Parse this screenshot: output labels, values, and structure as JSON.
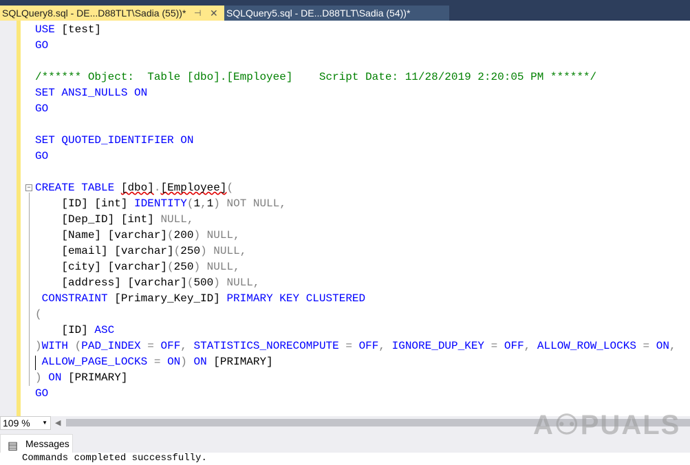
{
  "tabs": [
    {
      "label": "SQLQuery8.sql - DE...D88TLT\\Sadia (55))*",
      "active": true
    },
    {
      "label": "SQLQuery5.sql - DE...D88TLT\\Sadia (54))*",
      "active": false
    }
  ],
  "icons": {
    "pin": "⊣",
    "close": "✕",
    "collapse": "−",
    "zoom_dropdown": "▼",
    "scroll_left": "◀",
    "messages": "▤"
  },
  "colors": {
    "keyword": "#0000ff",
    "operator": "#808080",
    "comment": "#008000",
    "tab_active": "#ffe88a"
  },
  "code_lines": [
    [
      [
        "USE",
        "k"
      ],
      [
        " [test]",
        "n"
      ]
    ],
    [
      [
        "GO",
        "k"
      ]
    ],
    [],
    [
      [
        "/****** Object:  Table [dbo].[Employee]    Script Date: 11/28/2019 2:20:05 PM ******/",
        "c"
      ]
    ],
    [
      [
        "SET",
        "k"
      ],
      [
        " ",
        "n"
      ],
      [
        "ANSI_NULLS",
        "k"
      ],
      [
        " ",
        "n"
      ],
      [
        "ON",
        "k"
      ]
    ],
    [
      [
        "GO",
        "k"
      ]
    ],
    [],
    [
      [
        "SET",
        "k"
      ],
      [
        " ",
        "n"
      ],
      [
        "QUOTED_IDENTIFIER",
        "k"
      ],
      [
        " ",
        "n"
      ],
      [
        "ON",
        "k"
      ]
    ],
    [
      [
        "GO",
        "k"
      ]
    ],
    [],
    [
      [
        "CREATE",
        "k"
      ],
      [
        " ",
        "n"
      ],
      [
        "TABLE",
        "k"
      ],
      [
        " ",
        "n"
      ],
      [
        "[dbo]",
        "sq"
      ],
      [
        ".",
        "g"
      ],
      [
        "[Employee]",
        "sq"
      ],
      [
        "(",
        "g"
      ]
    ],
    [
      [
        "    [ID] [int] ",
        "n"
      ],
      [
        "IDENTITY",
        "k"
      ],
      [
        "(",
        "g"
      ],
      [
        "1",
        "n"
      ],
      [
        ",",
        "g"
      ],
      [
        "1",
        "n"
      ],
      [
        ")",
        "g"
      ],
      [
        " ",
        "n"
      ],
      [
        "NOT",
        "g"
      ],
      [
        " ",
        "n"
      ],
      [
        "NULL",
        "g"
      ],
      [
        ",",
        "g"
      ]
    ],
    [
      [
        "    [Dep_ID] [int] ",
        "n"
      ],
      [
        "NULL",
        "g"
      ],
      [
        ",",
        "g"
      ]
    ],
    [
      [
        "    [Name] [varchar]",
        "n"
      ],
      [
        "(",
        "g"
      ],
      [
        "200",
        "n"
      ],
      [
        ")",
        "g"
      ],
      [
        " ",
        "n"
      ],
      [
        "NULL",
        "g"
      ],
      [
        ",",
        "g"
      ]
    ],
    [
      [
        "    [email] [varchar]",
        "n"
      ],
      [
        "(",
        "g"
      ],
      [
        "250",
        "n"
      ],
      [
        ")",
        "g"
      ],
      [
        " ",
        "n"
      ],
      [
        "NULL",
        "g"
      ],
      [
        ",",
        "g"
      ]
    ],
    [
      [
        "    [city] [varchar]",
        "n"
      ],
      [
        "(",
        "g"
      ],
      [
        "250",
        "n"
      ],
      [
        ")",
        "g"
      ],
      [
        " ",
        "n"
      ],
      [
        "NULL",
        "g"
      ],
      [
        ",",
        "g"
      ]
    ],
    [
      [
        "    [address] [varchar]",
        "n"
      ],
      [
        "(",
        "g"
      ],
      [
        "500",
        "n"
      ],
      [
        ")",
        "g"
      ],
      [
        " ",
        "n"
      ],
      [
        "NULL",
        "g"
      ],
      [
        ",",
        "g"
      ]
    ],
    [
      [
        " ",
        "n"
      ],
      [
        "CONSTRAINT",
        "k"
      ],
      [
        " [Primary_Key_ID] ",
        "n"
      ],
      [
        "PRIMARY",
        "k"
      ],
      [
        " ",
        "n"
      ],
      [
        "KEY",
        "k"
      ],
      [
        " ",
        "n"
      ],
      [
        "CLUSTERED",
        "k"
      ]
    ],
    [
      [
        "(",
        "g"
      ]
    ],
    [
      [
        "    [ID] ",
        "n"
      ],
      [
        "ASC",
        "k"
      ]
    ],
    [
      [
        ")",
        "g"
      ],
      [
        "WITH",
        "k"
      ],
      [
        " ",
        "n"
      ],
      [
        "(",
        "g"
      ],
      [
        "PAD_INDEX",
        "k"
      ],
      [
        " ",
        "n"
      ],
      [
        "=",
        "g"
      ],
      [
        " ",
        "n"
      ],
      [
        "OFF",
        "k"
      ],
      [
        ",",
        "g"
      ],
      [
        " ",
        "n"
      ],
      [
        "STATISTICS_NORECOMPUTE",
        "k"
      ],
      [
        " ",
        "n"
      ],
      [
        "=",
        "g"
      ],
      [
        " ",
        "n"
      ],
      [
        "OFF",
        "k"
      ],
      [
        ",",
        "g"
      ],
      [
        " ",
        "n"
      ],
      [
        "IGNORE_DUP_KEY",
        "k"
      ],
      [
        " ",
        "n"
      ],
      [
        "=",
        "g"
      ],
      [
        " ",
        "n"
      ],
      [
        "OFF",
        "k"
      ],
      [
        ",",
        "g"
      ],
      [
        " ",
        "n"
      ],
      [
        "ALLOW_ROW_LOCKS",
        "k"
      ],
      [
        " ",
        "n"
      ],
      [
        "=",
        "g"
      ],
      [
        " ",
        "n"
      ],
      [
        "ON",
        "k"
      ],
      [
        ",",
        "g"
      ]
    ],
    [
      [
        " ",
        "n"
      ],
      [
        "ALLOW_PAGE_LOCKS",
        "k"
      ],
      [
        " ",
        "n"
      ],
      [
        "=",
        "g"
      ],
      [
        " ",
        "n"
      ],
      [
        "ON",
        "k"
      ],
      [
        ")",
        "g"
      ],
      [
        " ",
        "n"
      ],
      [
        "ON",
        "k"
      ],
      [
        " [PRIMARY]",
        "n"
      ]
    ],
    [
      [
        ")",
        "g"
      ],
      [
        " ",
        "n"
      ],
      [
        "ON",
        "k"
      ],
      [
        " [PRIMARY]",
        "n"
      ]
    ],
    [
      [
        "GO",
        "k"
      ]
    ]
  ],
  "zoom_level": "109 %",
  "messages_tab": "Messages",
  "messages_text": "Commands completed successfully.",
  "watermark": "APPUALS"
}
